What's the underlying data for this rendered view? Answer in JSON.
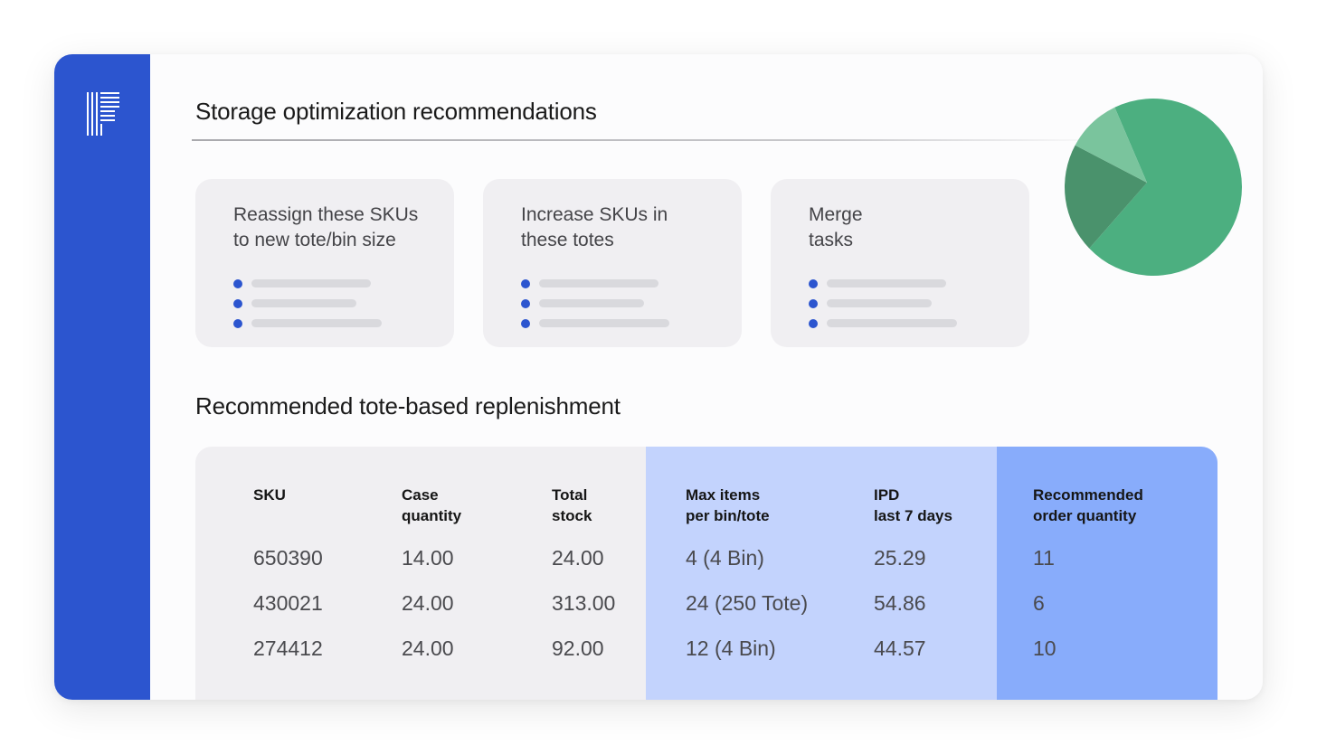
{
  "header": {
    "title": "Storage optimization recommendations"
  },
  "recommendations": [
    {
      "title_line1": "Reassign these SKUs",
      "title_line2": "to new tote/bin size"
    },
    {
      "title_line1": "Increase SKUs in",
      "title_line2": "these totes"
    },
    {
      "title_line1": "Merge",
      "title_line2": "tasks"
    }
  ],
  "pie_chart": {
    "type": "pie",
    "slices": [
      {
        "color": "#4caf80",
        "fraction": 0.7
      },
      {
        "color": "#4a926c",
        "fraction": 0.2
      },
      {
        "color": "#7ac49d",
        "fraction": 0.1
      }
    ]
  },
  "replenishment": {
    "title": "Recommended tote-based replenishment",
    "columns": [
      {
        "line1": "SKU",
        "line2": ""
      },
      {
        "line1": "Case",
        "line2": "quantity"
      },
      {
        "line1": "Total",
        "line2": "stock"
      },
      {
        "line1": "Max items",
        "line2": "per bin/tote"
      },
      {
        "line1": "IPD",
        "line2": "last 7 days"
      },
      {
        "line1": "Recommended",
        "line2": "order quantity"
      }
    ],
    "rows": [
      [
        "650390",
        "14.00",
        "24.00",
        "4 (4 Bin)",
        "25.29",
        "11"
      ],
      [
        "430021",
        "24.00",
        "313.00",
        "24 (250 Tote)",
        "54.86",
        "6"
      ],
      [
        "274412",
        "24.00",
        "92.00",
        "12 (4 Bin)",
        "44.57",
        "10"
      ]
    ]
  },
  "colors": {
    "sidebar": "#2c55cf",
    "accent_light": "#c3d3fd",
    "accent_mid": "#88acfb",
    "card_bg": "#f0eff2"
  }
}
